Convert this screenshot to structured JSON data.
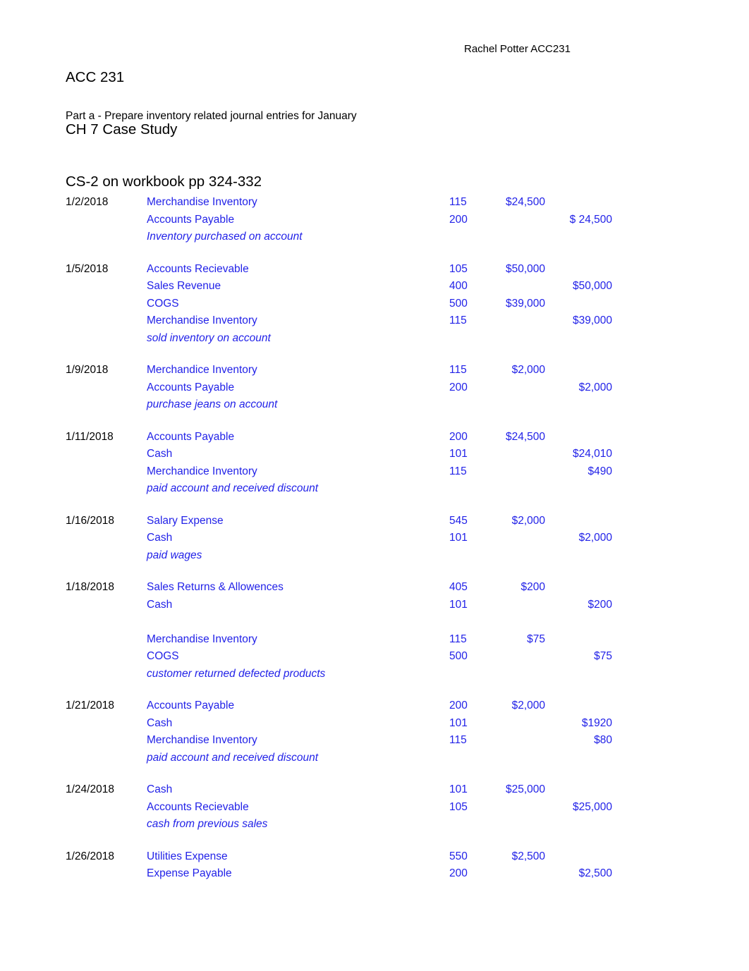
{
  "document": {
    "title_lines": [
      "ACC 231",
      "CH 7 Case Study",
      "CS-2 on workbook pp 324-332"
    ],
    "student_name": "Rachel Potter ACC231",
    "part_label": "Part a - Prepare inventory related journal entries for January",
    "colors": {
      "entry_blue": "#2222E8",
      "text_black": "#000000",
      "page_background": "#ffffff"
    }
  },
  "journal": {
    "entries": [
      {
        "date": "1/2/2018",
        "rows": [
          {
            "account": "Merchandise Inventory",
            "number": "115",
            "debit": "$24,500",
            "credit": ""
          },
          {
            "account": "Accounts Payable",
            "number": "200",
            "debit": "",
            "credit": "$ 24,500"
          },
          {
            "memo": "Inventory purchased on account"
          }
        ]
      },
      {
        "date": "1/5/2018",
        "rows": [
          {
            "account": "Accounts Recievable",
            "number": "105",
            "debit": "$50,000",
            "credit": ""
          },
          {
            "account": "Sales Revenue",
            "number": "400",
            "debit": "",
            "credit": "$50,000"
          },
          {
            "account": "COGS",
            "number": "500",
            "debit": "$39,000",
            "credit": ""
          },
          {
            "account": "Merchandise Inventory",
            "number": "115",
            "debit": "",
            "credit": "$39,000"
          },
          {
            "memo": "sold inventory on account"
          }
        ]
      },
      {
        "date": "1/9/2018",
        "rows": [
          {
            "account": "Merchandice Inventory",
            "number": "115",
            "debit": "$2,000",
            "credit": ""
          },
          {
            "account": "Accounts Payable",
            "number": "200",
            "debit": "",
            "credit": "$2,000"
          },
          {
            "memo": "purchase jeans on account"
          }
        ]
      },
      {
        "date": "1/11/2018",
        "rows": [
          {
            "account": "Accounts Payable",
            "number": "200",
            "debit": "$24,500",
            "credit": ""
          },
          {
            "account": "Cash",
            "number": "101",
            "debit": "",
            "credit": "$24,010"
          },
          {
            "account": "Merchandice Inventory",
            "number": "115",
            "debit": "",
            "credit": "$490"
          },
          {
            "memo": "paid account and received discount"
          }
        ]
      },
      {
        "date": "1/16/2018",
        "rows": [
          {
            "account": "Salary Expense",
            "number": "545",
            "debit": "$2,000",
            "credit": ""
          },
          {
            "account": "Cash",
            "number": "101",
            "debit": "",
            "credit": "$2,000"
          },
          {
            "memo": "paid wages"
          }
        ]
      },
      {
        "date": "1/18/2018",
        "rows": [
          {
            "account": "Sales Returns & Allowences",
            "number": "405",
            "debit": "$200",
            "credit": ""
          },
          {
            "account": "Cash",
            "number": "101",
            "debit": "",
            "credit": "$200"
          },
          {
            "spacer": true
          },
          {
            "account": "Merchandise Inventory",
            "number": "115",
            "debit": "$75",
            "credit": ""
          },
          {
            "account": "COGS",
            "number": "500",
            "debit": "",
            "credit": "$75"
          },
          {
            "memo": "customer returned defected products"
          }
        ]
      },
      {
        "date": "1/21/2018",
        "rows": [
          {
            "account": "Accounts Payable",
            "number": "200",
            "debit": "$2,000",
            "credit": ""
          },
          {
            "account": "Cash",
            "number": "101",
            "debit": "",
            "credit": "$1920"
          },
          {
            "account": "Merchandise Inventory",
            "number": "115",
            "debit": "",
            "credit": "$80"
          },
          {
            "memo": "paid account and received discount"
          }
        ]
      },
      {
        "date": "1/24/2018",
        "rows": [
          {
            "account": "Cash",
            "number": "101",
            "debit": "$25,000",
            "credit": ""
          },
          {
            "account": "Accounts Recievable",
            "number": "105",
            "debit": "",
            "credit": "$25,000"
          },
          {
            "memo": "cash from previous sales"
          }
        ]
      },
      {
        "date": "1/26/2018",
        "rows": [
          {
            "account": "Utilities Expense",
            "number": "550",
            "debit": "$2,500",
            "credit": ""
          },
          {
            "account": "Expense Payable",
            "number": "200",
            "debit": "",
            "credit": "$2,500"
          }
        ]
      }
    ]
  }
}
